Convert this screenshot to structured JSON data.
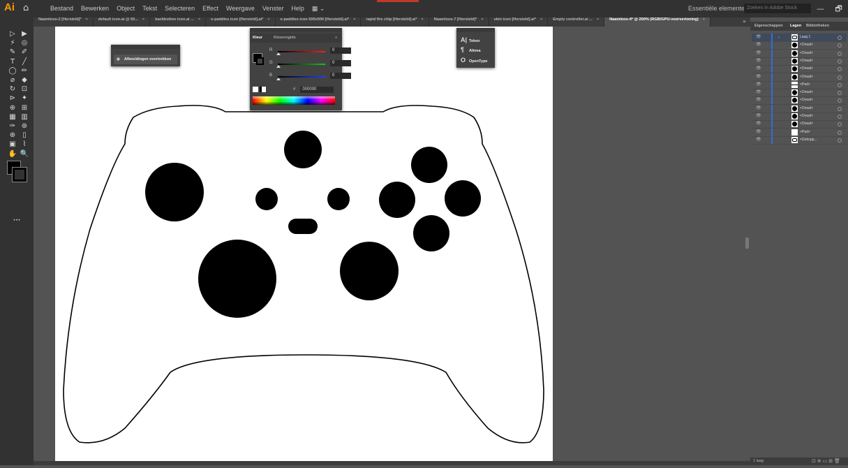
{
  "app": {
    "logo": "Ai",
    "home_icon": "home-icon",
    "accent": "#FF9A00"
  },
  "menu": {
    "items": [
      "Bestand",
      "Bewerken",
      "Object",
      "Tekst",
      "Selecteren",
      "Effect",
      "Weergave",
      "Venster",
      "Help"
    ],
    "workspace": "Essentiële elementen ⌄",
    "search_placeholder": "Zoeken in Adobe Stock",
    "window_controls": "— 🗗 ✕"
  },
  "tabs": [
    {
      "label": "Naamloos-2 [Hersteld]*",
      "active": false
    },
    {
      "label": "default icon.ai @ 50...",
      "active": false
    },
    {
      "label": "backbotton icon.ai ...",
      "active": false
    },
    {
      "label": "e-paddles icon [Hersteld].ai*",
      "active": false
    },
    {
      "label": "e-paddles icon 500x500 [Hersteld].ai*",
      "active": false
    },
    {
      "label": "rapid fire chip [Hersteld].ai*",
      "active": false
    },
    {
      "label": "Naamloos-7 [Hersteld]*",
      "active": false
    },
    {
      "label": "skin icon [Hersteld].ai*",
      "active": false
    },
    {
      "label": "Empty controller.ai ...",
      "active": false
    },
    {
      "label": "Naamloos-4* @ 200% (RGB/GPU-voorvertoning)",
      "active": true
    }
  ],
  "tabs_overflow": "»",
  "image_trace_panel": {
    "button": "Afbeeldingen overtrekken"
  },
  "color_panel": {
    "tabs": [
      "Kleur",
      "Kleurengids"
    ],
    "sliders": [
      {
        "label": "R",
        "value": "0",
        "color": "#ff2020"
      },
      {
        "label": "G",
        "value": "0",
        "color": "#20c020"
      },
      {
        "label": "B",
        "value": "0",
        "color": "#2040ff"
      }
    ],
    "hex_label": "#",
    "hex": "000000"
  },
  "character_panel": {
    "items": [
      {
        "icon": "A|",
        "label": "Teken"
      },
      {
        "icon": "¶",
        "label": "Alinea"
      },
      {
        "icon": "O",
        "label": "OpenType"
      }
    ]
  },
  "right_panel": {
    "tabs": [
      "Eigenschappen",
      "Lagen",
      "Bibliotheken"
    ],
    "active_tab": "Lagen",
    "layers": [
      {
        "name": "Laag 1",
        "main": true,
        "thumb": "controller"
      },
      {
        "name": "<Ovaal>",
        "thumb": "dot"
      },
      {
        "name": "<Ovaal>",
        "thumb": "dot"
      },
      {
        "name": "<Ovaal>",
        "thumb": "dot"
      },
      {
        "name": "<Ovaal>",
        "thumb": "dot"
      },
      {
        "name": "<Ovaal>",
        "thumb": "dot"
      },
      {
        "name": "<Pad>",
        "thumb": "line"
      },
      {
        "name": "<Ovaal>",
        "thumb": "dot"
      },
      {
        "name": "<Ovaal>",
        "thumb": "dot"
      },
      {
        "name": "<Ovaal>",
        "thumb": "dot"
      },
      {
        "name": "<Ovaal>",
        "thumb": "dot"
      },
      {
        "name": "<Ovaal>",
        "thumb": "dot"
      },
      {
        "name": "<Pad>",
        "thumb": "blank"
      },
      {
        "name": "<Gekopp...",
        "thumb": "controller"
      }
    ],
    "footer": "1 laag"
  },
  "colors": {
    "ui_dark": "#323232",
    "canvas": "#535353",
    "artboard": "#FFFFFF",
    "layer_accent": "#2f6fd6"
  }
}
